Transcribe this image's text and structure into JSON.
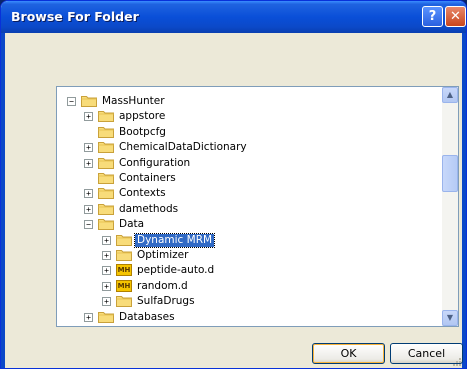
{
  "window": {
    "title": "Browse For Folder",
    "help_glyph": "?",
    "close_glyph": "✕"
  },
  "tree": {
    "items": [
      {
        "label": "MassHunter",
        "level": 0,
        "expander": "−",
        "icon": "folder-icon"
      },
      {
        "label": "appstore",
        "level": 1,
        "expander": "+",
        "icon": "folder-icon"
      },
      {
        "label": "Bootpcfg",
        "level": 1,
        "expander": "",
        "icon": "folder-icon"
      },
      {
        "label": "ChemicalDataDictionary",
        "level": 1,
        "expander": "+",
        "icon": "folder-icon"
      },
      {
        "label": "Configuration",
        "level": 1,
        "expander": "+",
        "icon": "folder-icon"
      },
      {
        "label": "Containers",
        "level": 1,
        "expander": "",
        "icon": "folder-icon"
      },
      {
        "label": "Contexts",
        "level": 1,
        "expander": "+",
        "icon": "folder-icon"
      },
      {
        "label": "damethods",
        "level": 1,
        "expander": "+",
        "icon": "folder-icon"
      },
      {
        "label": "Data",
        "level": 1,
        "expander": "−",
        "icon": "folder-icon"
      },
      {
        "label": "Dynamic MRM",
        "level": 2,
        "expander": "+",
        "icon": "folder-icon",
        "selected": true
      },
      {
        "label": "Optimizer",
        "level": 2,
        "expander": "+",
        "icon": "folder-icon"
      },
      {
        "label": "peptide-auto.d",
        "level": 2,
        "expander": "+",
        "icon": "mh-icon",
        "icon_text": "MH"
      },
      {
        "label": "random.d",
        "level": 2,
        "expander": "+",
        "icon": "mh-icon",
        "icon_text": "MH"
      },
      {
        "label": "SulfaDrugs",
        "level": 2,
        "expander": "+",
        "icon": "folder-icon"
      },
      {
        "label": "Databases",
        "level": 1,
        "expander": "+",
        "icon": "folder-icon"
      }
    ]
  },
  "scroll": {
    "up_glyph": "▲",
    "down_glyph": "▼"
  },
  "buttons": {
    "ok": "OK",
    "cancel": "Cancel"
  }
}
